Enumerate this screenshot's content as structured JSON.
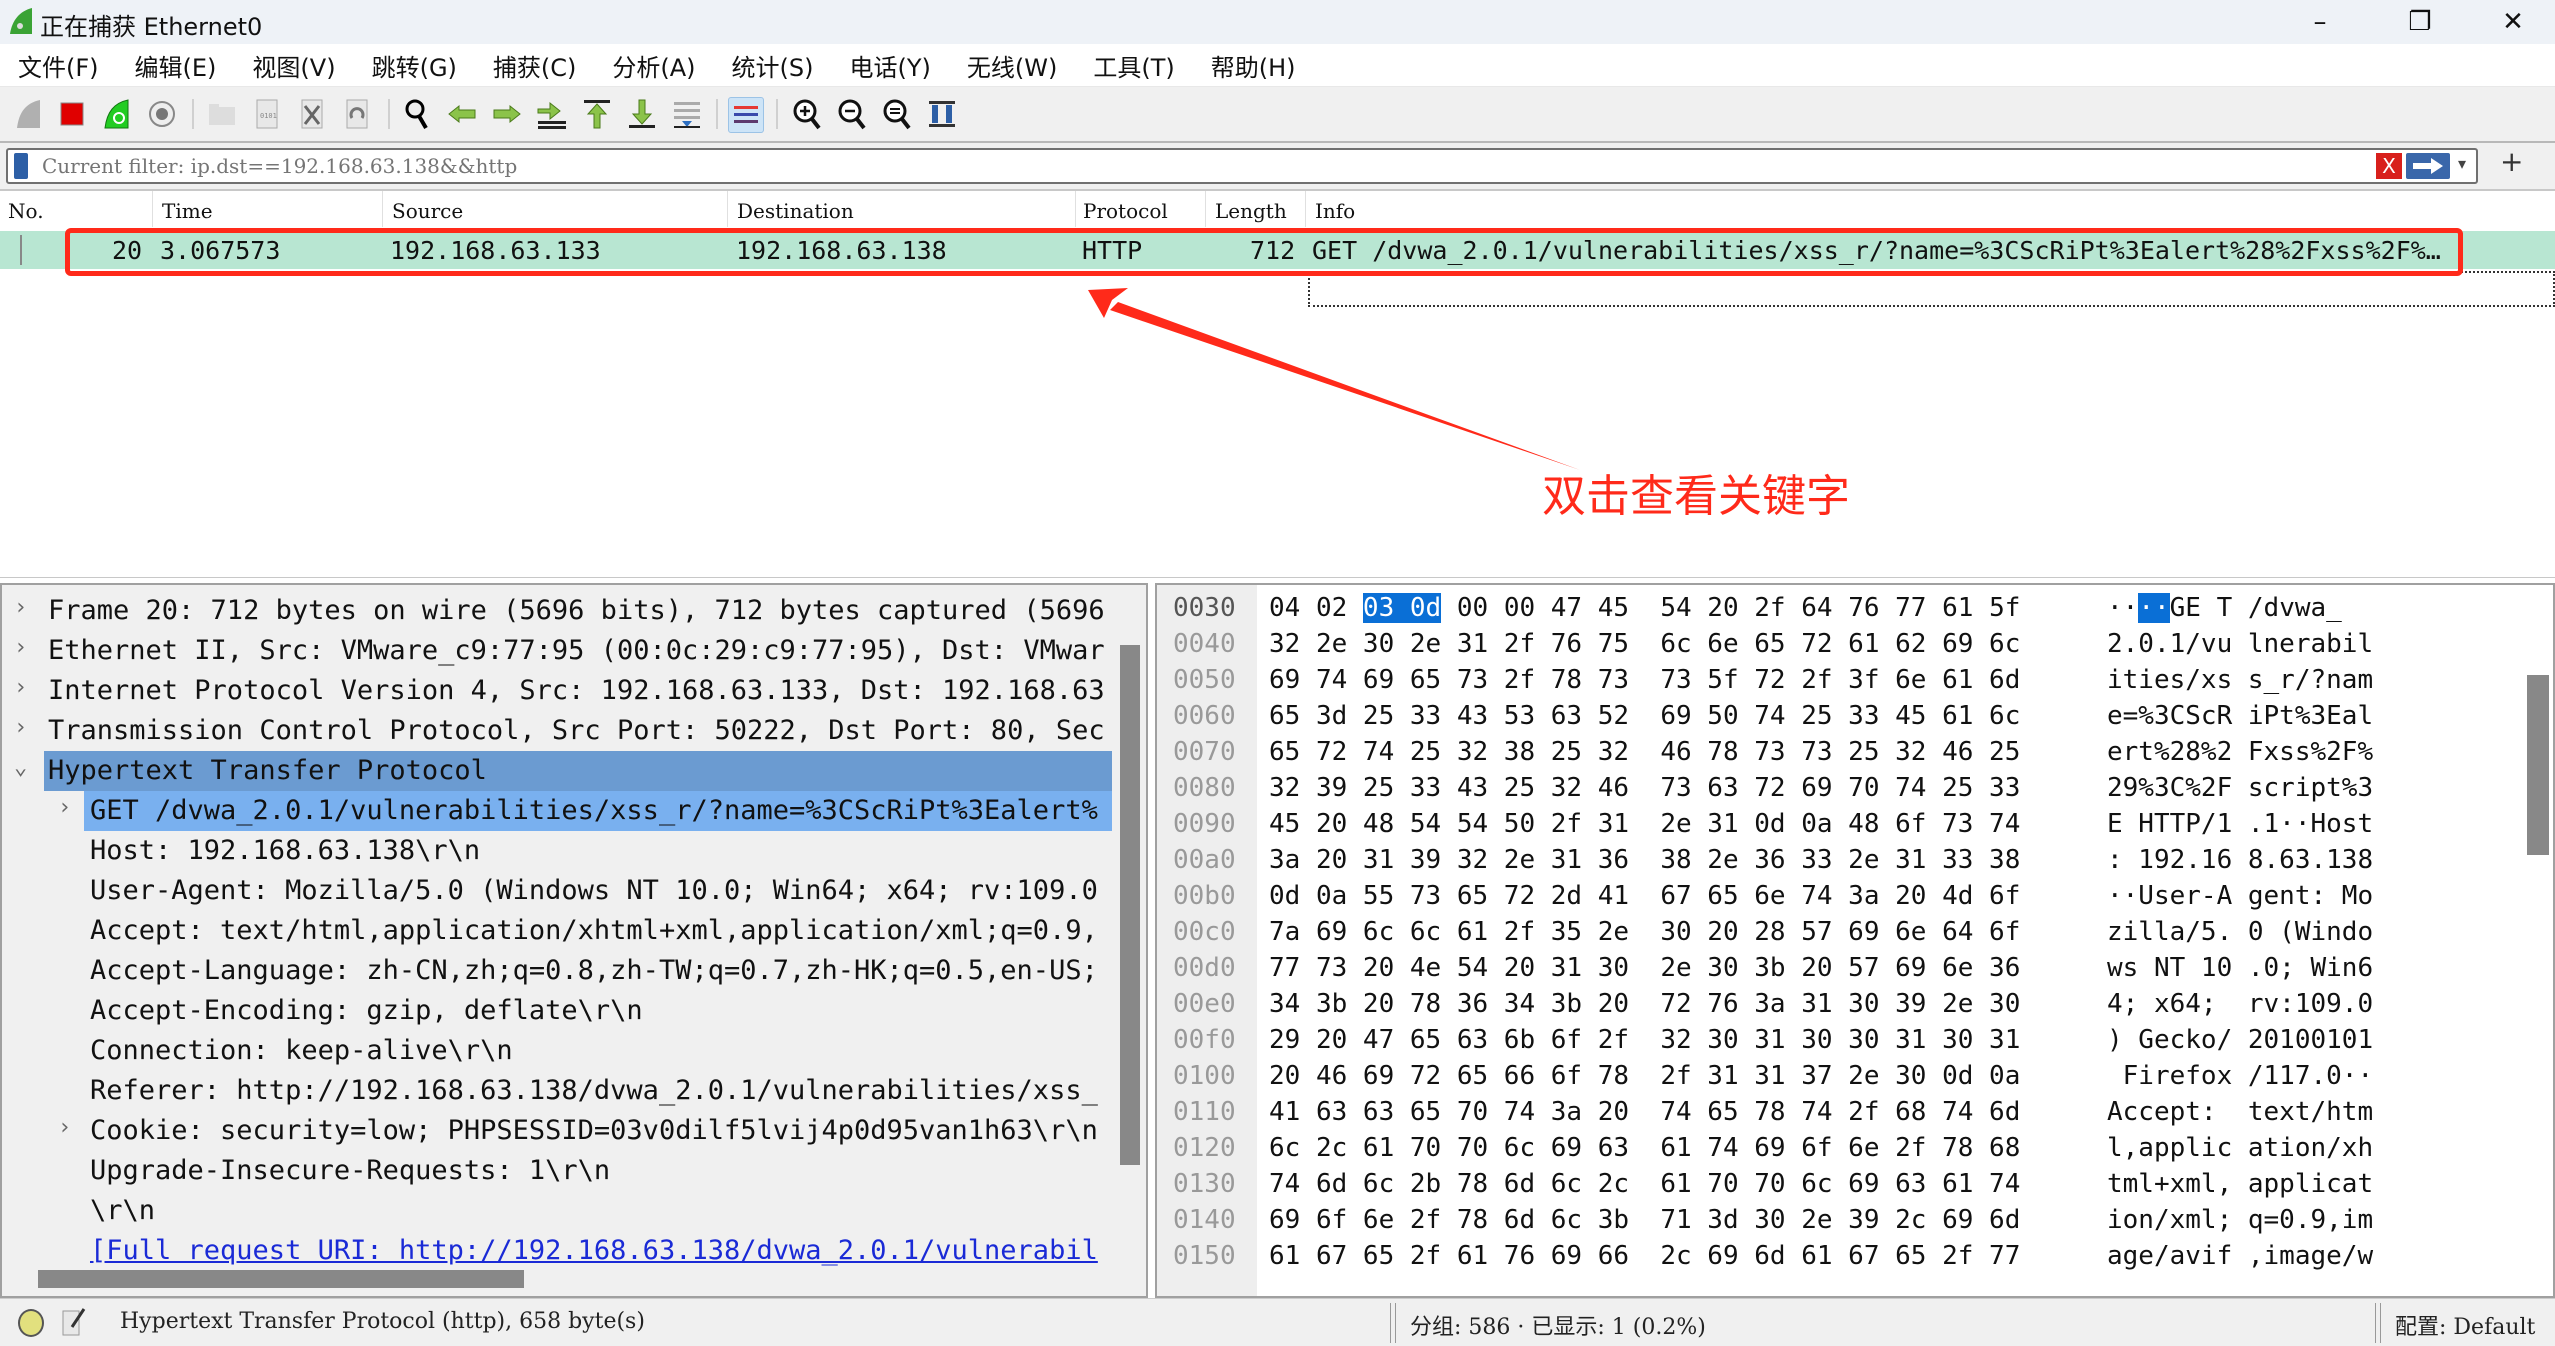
{
  "window": {
    "title": "正在捕获 Ethernet0",
    "minimize_glyph": "–",
    "maximize_glyph": "❐",
    "close_glyph": "✕"
  },
  "menu": [
    "文件(F)",
    "编辑(E)",
    "视图(V)",
    "跳转(G)",
    "捕获(C)",
    "分析(A)",
    "统计(S)",
    "电话(Y)",
    "无线(W)",
    "工具(T)",
    "帮助(H)"
  ],
  "toolbar": {
    "icons": [
      "start-capture-icon",
      "stop-capture-icon",
      "restart-capture-icon",
      "capture-options-icon",
      "open-file-icon",
      "save-file-icon",
      "close-file-icon",
      "reload-file-icon",
      "find-packet-icon",
      "go-back-icon",
      "go-forward-icon",
      "go-to-packet-icon",
      "go-first-icon",
      "go-last-icon",
      "autoscroll-icon",
      "colorize-icon",
      "zoom-in-icon",
      "zoom-out-icon",
      "zoom-normal-icon",
      "resize-columns-icon"
    ]
  },
  "filter": {
    "placeholder": "Current filter: ip.dst==192.168.63.138&&http",
    "value": "",
    "clear_glyph": "X",
    "dropdown_glyph": "▾",
    "add_glyph": "+"
  },
  "packet_list": {
    "columns": [
      "No.",
      "Time",
      "Source",
      "Destination",
      "Protocol",
      "Length",
      "Info"
    ],
    "rows": [
      {
        "no": "20",
        "time": "3.067573",
        "source": "192.168.63.133",
        "destination": "192.168.63.138",
        "protocol": "HTTP",
        "length": "712",
        "info": "GET /dvwa_2.0.1/vulnerabilities/xss_r/?name=%3CScRiPt%3Ealert%28%2Fxss%2F%…",
        "color": "#b8e6d2"
      }
    ]
  },
  "annotation": {
    "text": "双击查看关键字",
    "color": "#ff2a1a"
  },
  "details": {
    "rows": [
      {
        "expander": "›",
        "text": "Frame 20: 712 bytes on wire (5696 bits), 712 bytes captured (5696"
      },
      {
        "expander": "›",
        "text": "Ethernet II, Src: VMware_c9:77:95 (00:0c:29:c9:77:95), Dst: VMwar"
      },
      {
        "expander": "›",
        "text": "Internet Protocol Version 4, Src: 192.168.63.133, Dst: 192.168.63"
      },
      {
        "expander": "›",
        "text": "Transmission Control Protocol, Src Port: 50222, Dst Port: 80, Sec"
      },
      {
        "expander": "⌄",
        "text": "Hypertext Transfer Protocol"
      },
      {
        "expander": "›",
        "text": "GET /dvwa_2.0.1/vulnerabilities/xss_r/?name=%3CScRiPt%3Ealert%"
      },
      {
        "expander": "",
        "text": "Host: 192.168.63.138\\r\\n"
      },
      {
        "expander": "",
        "text": "User-Agent: Mozilla/5.0 (Windows NT 10.0; Win64; x64; rv:109.0"
      },
      {
        "expander": "",
        "text": "Accept: text/html,application/xhtml+xml,application/xml;q=0.9,"
      },
      {
        "expander": "",
        "text": "Accept-Language: zh-CN,zh;q=0.8,zh-TW;q=0.7,zh-HK;q=0.5,en-US;"
      },
      {
        "expander": "",
        "text": "Accept-Encoding: gzip, deflate\\r\\n"
      },
      {
        "expander": "",
        "text": "Connection: keep-alive\\r\\n"
      },
      {
        "expander": "",
        "text": "Referer: http://192.168.63.138/dvwa_2.0.1/vulnerabilities/xss_"
      },
      {
        "expander": "›",
        "text": "Cookie: security=low; PHPSESSID=03v0dilf5lvij4p0d95van1h63\\r\\n"
      },
      {
        "expander": "",
        "text": "Upgrade-Insecure-Requests: 1\\r\\n"
      },
      {
        "expander": "",
        "text": "\\r\\n"
      },
      {
        "expander": "",
        "text": "[Full request URI: http://192.168.63.138/dvwa_2.0.1/vulnerabil"
      }
    ]
  },
  "hex": {
    "rows": [
      {
        "offset": "0030",
        "bytes": "04 02 03 0d 00 00 47 45  54 20 2f 64 76 77 61 5f",
        "ascii": "····GE T /dvwa_"
      },
      {
        "offset": "0040",
        "bytes": "32 2e 30 2e 31 2f 76 75  6c 6e 65 72 61 62 69 6c",
        "ascii": "2.0.1/vu lnerabil"
      },
      {
        "offset": "0050",
        "bytes": "69 74 69 65 73 2f 78 73  73 5f 72 2f 3f 6e 61 6d",
        "ascii": "ities/xs s_r/?nam"
      },
      {
        "offset": "0060",
        "bytes": "65 3d 25 33 43 53 63 52  69 50 74 25 33 45 61 6c",
        "ascii": "e=%3CScR iPt%3Eal"
      },
      {
        "offset": "0070",
        "bytes": "65 72 74 25 32 38 25 32  46 78 73 73 25 32 46 25",
        "ascii": "ert%28%2 Fxss%2F%"
      },
      {
        "offset": "0080",
        "bytes": "32 39 25 33 43 25 32 46  73 63 72 69 70 74 25 33",
        "ascii": "29%3C%2F script%3"
      },
      {
        "offset": "0090",
        "bytes": "45 20 48 54 54 50 2f 31  2e 31 0d 0a 48 6f 73 74",
        "ascii": "E HTTP/1 .1··Host"
      },
      {
        "offset": "00a0",
        "bytes": "3a 20 31 39 32 2e 31 36  38 2e 36 33 2e 31 33 38",
        "ascii": ": 192.16 8.63.138"
      },
      {
        "offset": "00b0",
        "bytes": "0d 0a 55 73 65 72 2d 41  67 65 6e 74 3a 20 4d 6f",
        "ascii": "··User-A gent: Mo"
      },
      {
        "offset": "00c0",
        "bytes": "7a 69 6c 6c 61 2f 35 2e  30 20 28 57 69 6e 64 6f",
        "ascii": "zilla/5. 0 (Windo"
      },
      {
        "offset": "00d0",
        "bytes": "77 73 20 4e 54 20 31 30  2e 30 3b 20 57 69 6e 36",
        "ascii": "ws NT 10 .0; Win6"
      },
      {
        "offset": "00e0",
        "bytes": "34 3b 20 78 36 34 3b 20  72 76 3a 31 30 39 2e 30",
        "ascii": "4; x64;  rv:109.0"
      },
      {
        "offset": "00f0",
        "bytes": "29 20 47 65 63 6b 6f 2f  32 30 31 30 30 31 30 31",
        "ascii": ") Gecko/ 20100101"
      },
      {
        "offset": "0100",
        "bytes": "20 46 69 72 65 66 6f 78  2f 31 31 37 2e 30 0d 0a",
        "ascii": " Firefox /117.0··"
      },
      {
        "offset": "0110",
        "bytes": "41 63 63 65 70 74 3a 20  74 65 78 74 2f 68 74 6d",
        "ascii": "Accept:  text/htm"
      },
      {
        "offset": "0120",
        "bytes": "6c 2c 61 70 70 6c 69 63  61 74 69 6f 6e 2f 78 68",
        "ascii": "l,applic ation/xh"
      },
      {
        "offset": "0130",
        "bytes": "74 6d 6c 2b 78 6d 6c 2c  61 70 70 6c 69 63 61 74",
        "ascii": "tml+xml, applicat"
      },
      {
        "offset": "0140",
        "bytes": "69 6f 6e 2f 78 6d 6c 3b  71 3d 30 2e 39 2c 69 6d",
        "ascii": "ion/xml; q=0.9,im"
      },
      {
        "offset": "0150",
        "bytes": "61 67 65 2f 61 76 69 66  2c 69 6d 61 67 65 2f 77",
        "ascii": "age/avif ,image/w"
      }
    ],
    "selected_bytes": "03 0d"
  },
  "status": {
    "text": "Hypertext Transfer Protocol (http), 658 byte(s)",
    "packets": "分组: 586 · 已显示: 1 (0.2%)",
    "profile": "配置: Default"
  }
}
